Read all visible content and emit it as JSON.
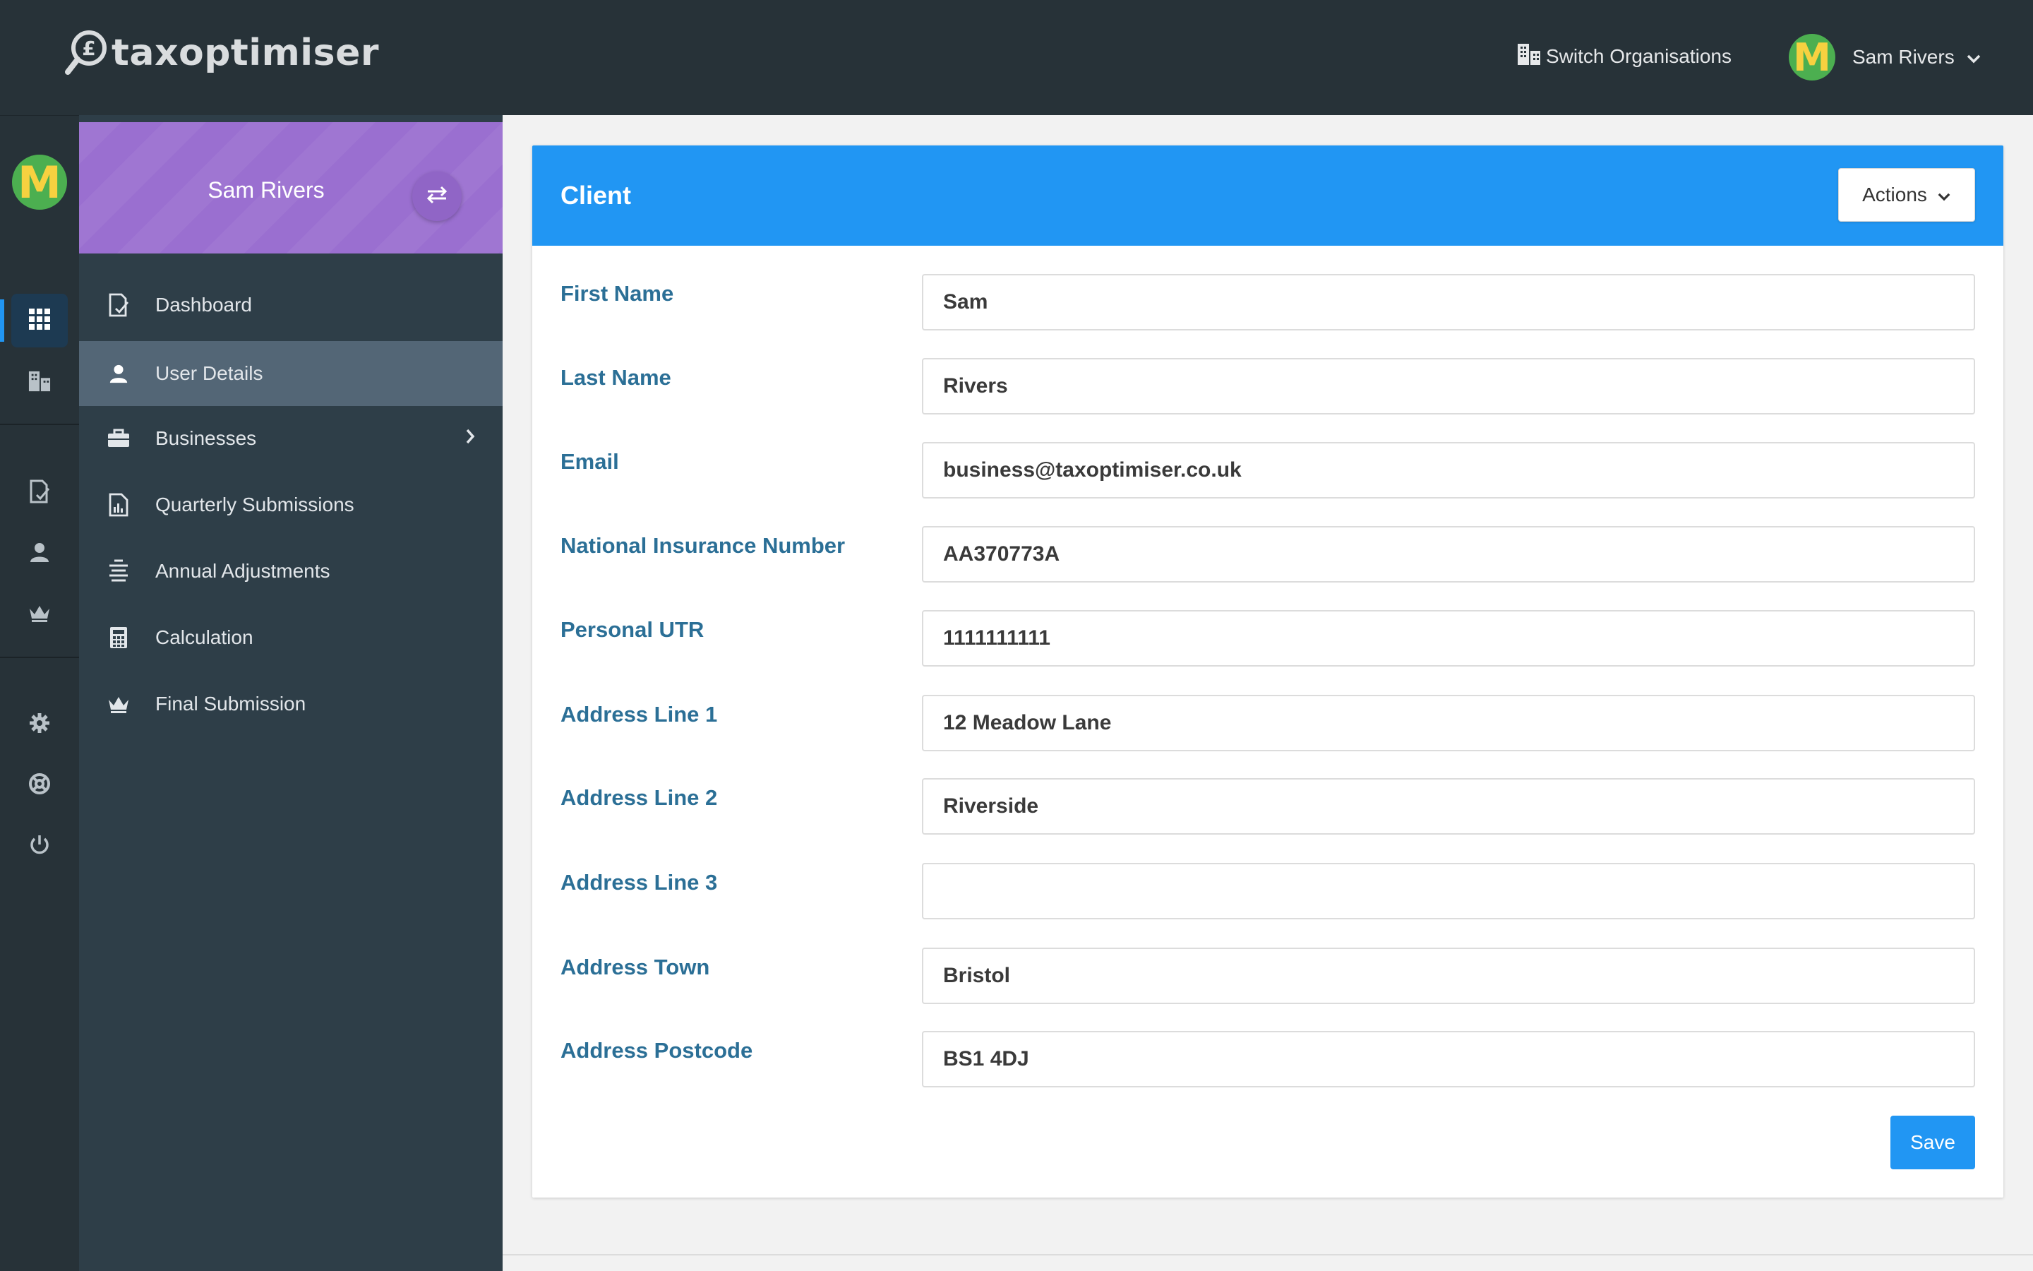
{
  "brand": {
    "name": "taxoptimiser"
  },
  "topbar": {
    "switch_org_label": "Switch Organisations",
    "user_name": "Sam Rivers",
    "avatar_letter": "M"
  },
  "rail": {
    "avatar_letter": "M",
    "icons": [
      "apps-grid-icon",
      "building-icon",
      "document-check-icon",
      "user-icon",
      "crown-icon",
      "gear-icon",
      "lifebuoy-icon",
      "power-icon"
    ]
  },
  "sidebar": {
    "header_name": "Sam Rivers",
    "items": [
      {
        "label": "Dashboard",
        "icon": "document-check-icon",
        "active": false
      },
      {
        "label": "User Details",
        "icon": "user-icon",
        "active": true
      },
      {
        "label": "Businesses",
        "icon": "briefcase-icon",
        "active": false,
        "has_submenu": true
      },
      {
        "label": "Quarterly Submissions",
        "icon": "report-icon",
        "active": false
      },
      {
        "label": "Annual Adjustments",
        "icon": "list-icon",
        "active": false
      },
      {
        "label": "Calculation",
        "icon": "calculator-icon",
        "active": false
      },
      {
        "label": "Final Submission",
        "icon": "crown-icon",
        "active": false
      }
    ]
  },
  "card": {
    "title": "Client",
    "actions_label": "Actions",
    "save_label": "Save",
    "fields": [
      {
        "label": "First Name",
        "value": "Sam"
      },
      {
        "label": "Last Name",
        "value": "Rivers"
      },
      {
        "label": "Email",
        "value": "business@taxoptimiser.co.uk"
      },
      {
        "label": "National Insurance Number",
        "value": "AA370773A"
      },
      {
        "label": "Personal UTR",
        "value": "1111111111"
      },
      {
        "label": "Address Line 1",
        "value": "12 Meadow Lane"
      },
      {
        "label": "Address Line 2",
        "value": "Riverside"
      },
      {
        "label": "Address Line 3",
        "value": ""
      },
      {
        "label": "Address Town",
        "value": "Bristol"
      },
      {
        "label": "Address Postcode",
        "value": "BS1 4DJ"
      }
    ]
  },
  "colors": {
    "topbar_bg": "#273238",
    "sidebar_bg": "#2e3e48",
    "sidebar_header_bg": "#9a6fd0",
    "accent": "#2196f3",
    "label_text": "#2b6f96",
    "avatar_bg": "#4caf50",
    "avatar_letter": "#f7d140"
  }
}
